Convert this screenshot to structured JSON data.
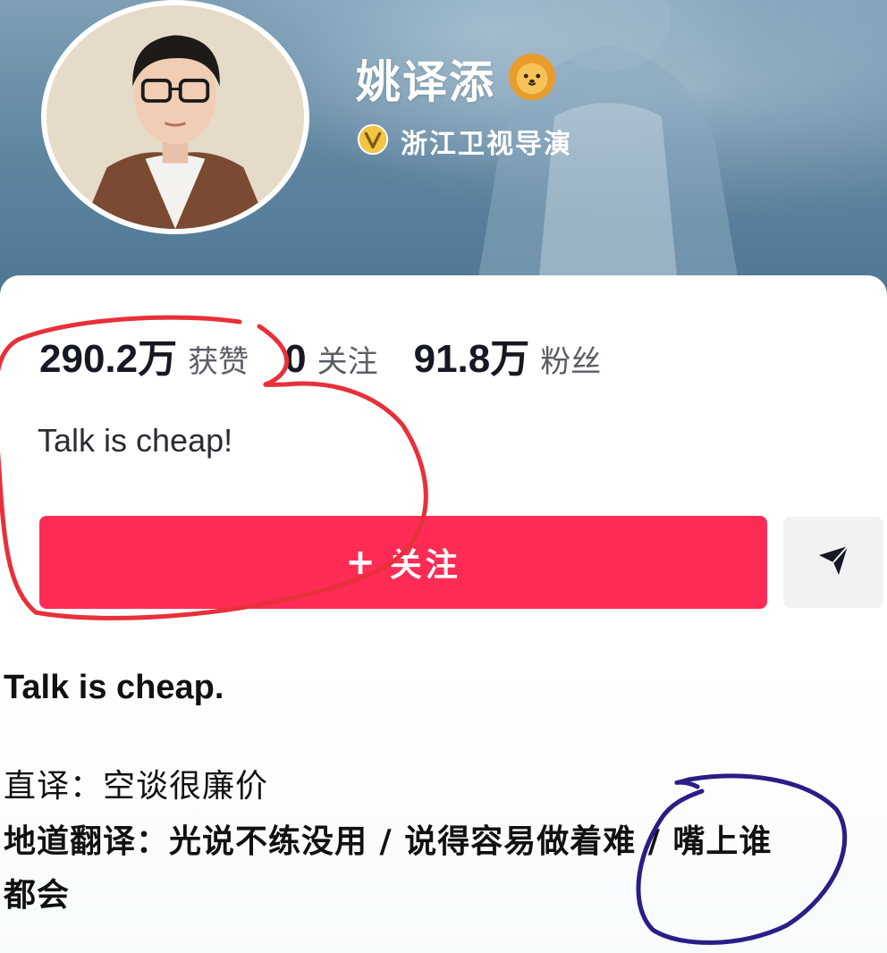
{
  "profile": {
    "nickname": "姚译添",
    "verification": "浙江卫视导演"
  },
  "stats": [
    {
      "value": "290.2万",
      "label": "获赞"
    },
    {
      "value": "0",
      "label": "关注"
    },
    {
      "value": "91.8万",
      "label": "粉丝"
    }
  ],
  "bio": "Talk is cheap!",
  "actions": {
    "follow_label": "关注",
    "follow_plus": "+"
  },
  "caption": {
    "title": "Talk is cheap.",
    "line1": "直译：空谈很廉价",
    "line2": "地道翻译：光说不练没用 / 说得容易做着难 / 嘴上谁",
    "line3": "都会"
  },
  "colors": {
    "accent": "#fe2c55",
    "cover": "#5e84a0",
    "annotation_red": "#e8303a",
    "annotation_blue": "#2a1d86"
  },
  "icons": [
    "lion-badge-icon",
    "verified-v-icon",
    "share-arrow-icon",
    "plus-icon"
  ]
}
